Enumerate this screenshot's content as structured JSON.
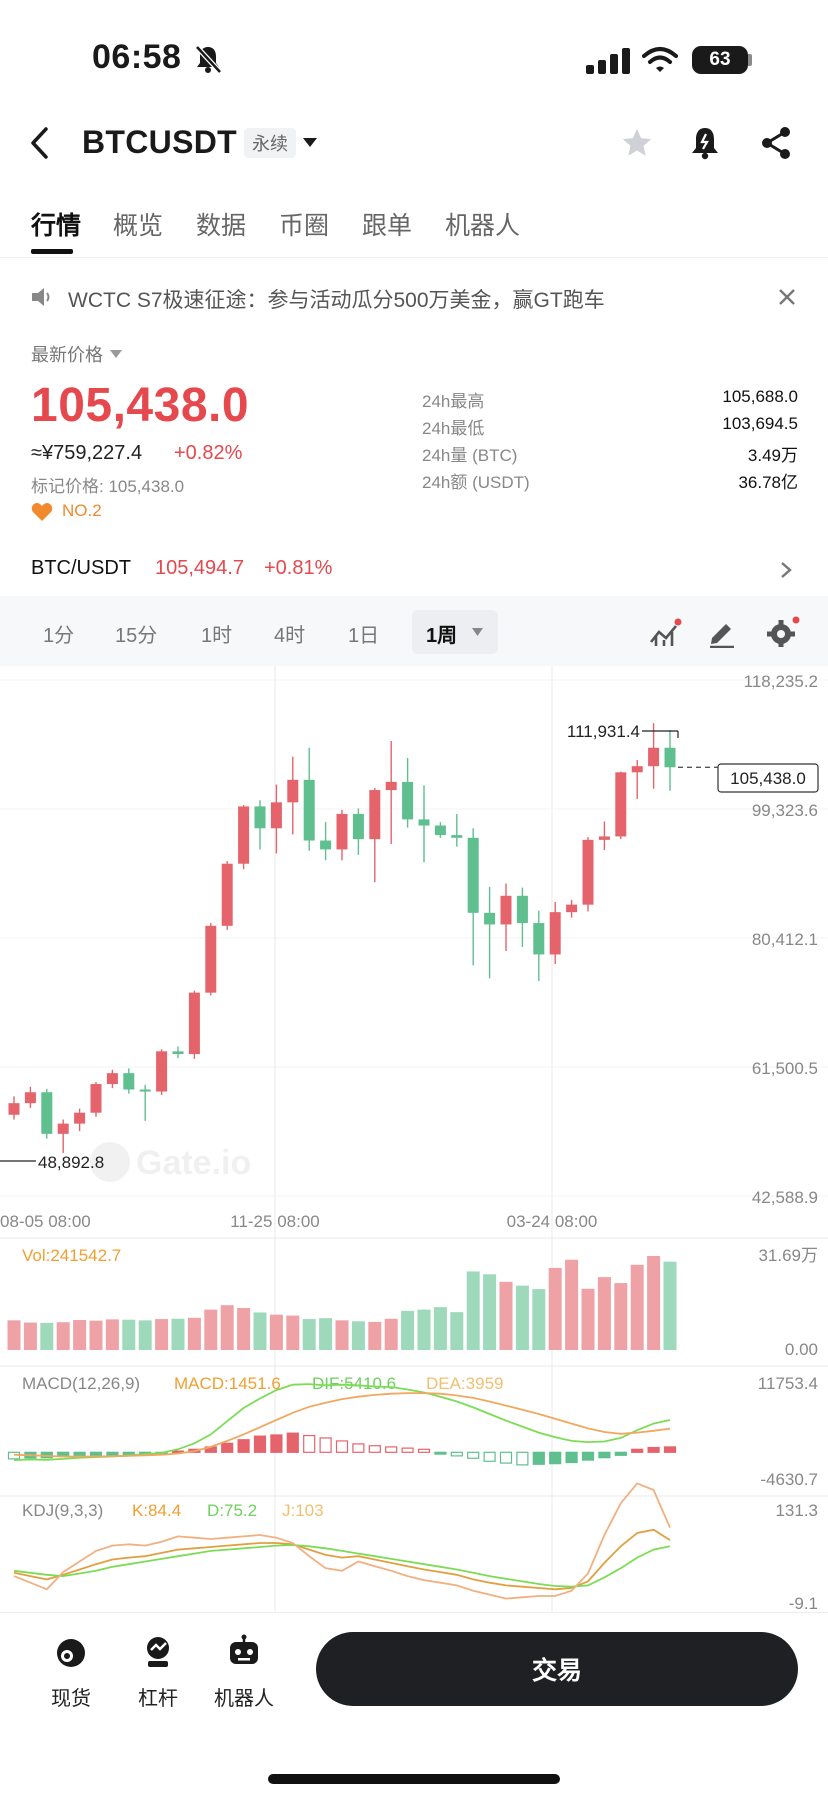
{
  "status_bar": {
    "time": "06:58",
    "battery": "63"
  },
  "header": {
    "pair": "BTCUSDT",
    "contract_type": "永续"
  },
  "tabs": [
    "行情",
    "概览",
    "数据",
    "币圈",
    "跟单",
    "机器人"
  ],
  "announcement": "WCTC S7极速征途：参与活动瓜分500万美金，赢GT跑车",
  "price": {
    "label": "最新价格",
    "last": "105,438.0",
    "cny": "≈¥759,227.4",
    "change": "+0.82%",
    "mark": "标记价格: 105,438.0",
    "rank": "NO.2"
  },
  "stats": [
    {
      "label": "24h最高",
      "value": "105,688.0"
    },
    {
      "label": "24h最低",
      "value": "103,694.5"
    },
    {
      "label": "24h量 (BTC)",
      "value": "3.49万"
    },
    {
      "label": "24h额 (USDT)",
      "value": "36.78亿"
    }
  ],
  "spot": {
    "pair": "BTC/USDT",
    "price": "105,494.7",
    "change": "+0.81%"
  },
  "intervals": [
    "1分",
    "15分",
    "1时",
    "4时",
    "1日",
    "1周"
  ],
  "active_interval": "1周",
  "colors": {
    "up": "#e5636b",
    "down": "#5fbf8e",
    "price_red": "#e5484d"
  },
  "chart_data": {
    "type": "candlestick",
    "y_axis_labels": [
      "118,235.2",
      "99,323.6",
      "80,412.1",
      "61,500.5",
      "42,588.9"
    ],
    "x_axis_labels": [
      "08-05 08:00",
      "11-25 08:00",
      "03-24 08:00"
    ],
    "ylim": [
      42588.9,
      118235.2
    ],
    "high_marker": "111,931.4",
    "low_marker": "48,892.8",
    "current_price_tag": "105,438.0",
    "watermark": "Gate.io",
    "candles": [
      [
        54500,
        57200,
        53800,
        56200
      ],
      [
        56200,
        58600,
        55500,
        57800
      ],
      [
        57800,
        58300,
        51000,
        51700
      ],
      [
        51700,
        53800,
        48900,
        53200
      ],
      [
        53200,
        55400,
        52100,
        54800
      ],
      [
        54800,
        59300,
        54200,
        59000
      ],
      [
        59000,
        61100,
        58400,
        60600
      ],
      [
        60600,
        61300,
        57600,
        58200
      ],
      [
        58200,
        58900,
        53600,
        57900
      ],
      [
        57900,
        64100,
        57400,
        63800
      ],
      [
        63800,
        64500,
        62800,
        63400
      ],
      [
        63400,
        72700,
        62700,
        72400
      ],
      [
        72400,
        82600,
        72000,
        82200
      ],
      [
        82200,
        91700,
        81600,
        91300
      ],
      [
        91300,
        99900,
        90500,
        99700
      ],
      [
        99700,
        100600,
        93400,
        96500
      ],
      [
        96500,
        102900,
        92800,
        100300
      ],
      [
        100300,
        107000,
        95600,
        103600
      ],
      [
        103600,
        108300,
        93200,
        94700
      ],
      [
        94700,
        97400,
        91800,
        93400
      ],
      [
        93400,
        99200,
        91800,
        98600
      ],
      [
        98600,
        99400,
        92600,
        94900
      ],
      [
        94900,
        102400,
        88600,
        102100
      ],
      [
        102100,
        109300,
        94200,
        103300
      ],
      [
        103300,
        106800,
        96600,
        97800
      ],
      [
        97800,
        102800,
        91500,
        96900
      ],
      [
        96900,
        97400,
        95100,
        95500
      ],
      [
        95500,
        98600,
        93800,
        95100
      ],
      [
        95100,
        96500,
        76400,
        84100
      ],
      [
        84100,
        87900,
        74500,
        82400
      ],
      [
        82400,
        88400,
        78500,
        86600
      ],
      [
        86600,
        87800,
        79100,
        82600
      ],
      [
        82600,
        84400,
        74100,
        78000
      ],
      [
        78000,
        85700,
        76600,
        84200
      ],
      [
        84200,
        86000,
        83400,
        85300
      ],
      [
        85300,
        95200,
        84300,
        94800
      ],
      [
        94800,
        97500,
        93300,
        95300
      ],
      [
        95300,
        104800,
        94900,
        104700
      ],
      [
        104700,
        106500,
        100800,
        105600
      ],
      [
        105600,
        111900,
        102300,
        108300
      ],
      [
        108300,
        110900,
        102000,
        105438
      ]
    ],
    "volume": {
      "label": "Vol:241542.7",
      "axis_top": "31.69万",
      "axis_bottom": "0.00",
      "values": [
        9.4,
        8.7,
        8.6,
        8.8,
        9.5,
        9.3,
        9.7,
        9.6,
        9.4,
        9.8,
        9.9,
        10.2,
        12.8,
        14.2,
        13.3,
        11.9,
        11.2,
        10.9,
        9.8,
        10.1,
        9.4,
        9.1,
        8.9,
        9.9,
        12.4,
        12.8,
        13.6,
        12.0,
        24.9,
        24.0,
        21.6,
        20.4,
        19.3,
        26.0,
        28.6,
        19.4,
        23.1,
        21.2,
        27.0,
        29.8,
        28.0
      ]
    },
    "macd": {
      "label": "MACD(12,26,9)",
      "macd": "MACD:1451.6",
      "dif": "DIF:5410.6",
      "dea": "DEA:3959",
      "axis_top": "11753.4",
      "axis_bottom": "-4630.7",
      "hist": [
        -1100,
        -950,
        -900,
        -700,
        -600,
        -500,
        -450,
        -350,
        -250,
        -100,
        200,
        500,
        900,
        1500,
        2100,
        2700,
        2900,
        3200,
        2800,
        2400,
        1900,
        1400,
        1100,
        900,
        700,
        500,
        -300,
        -600,
        -1000,
        -1500,
        -1800,
        -2100,
        -2000,
        -1900,
        -1700,
        -1300,
        -900,
        -500,
        500,
        800,
        900
      ],
      "dif_line": [
        -1300,
        -1200,
        -1250,
        -1100,
        -900,
        -800,
        -700,
        -500,
        -300,
        -100,
        500,
        1500,
        3000,
        5200,
        7400,
        9000,
        10400,
        11300,
        11400,
        11200,
        11300,
        11200,
        11000,
        10900,
        10500,
        10000,
        9300,
        8500,
        7500,
        6400,
        5300,
        4300,
        3300,
        2500,
        1900,
        1700,
        1800,
        2400,
        3700,
        4800,
        5400
      ],
      "dea_line": [
        -400,
        -500,
        -600,
        -700,
        -700,
        -700,
        -650,
        -600,
        -500,
        -400,
        -200,
        200,
        900,
        1900,
        3000,
        4200,
        5400,
        6600,
        7600,
        8300,
        8900,
        9300,
        9600,
        9800,
        9900,
        9900,
        9800,
        9500,
        9100,
        8500,
        7800,
        7100,
        6400,
        5600,
        4800,
        4000,
        3400,
        3100,
        3300,
        3600,
        3959
      ]
    },
    "kdj": {
      "label": "KDJ(9,3,3)",
      "k": "K:84.4",
      "d": "D:75.2",
      "j": "J:103",
      "axis_top": "131.3",
      "axis_bottom": "-9.1",
      "k_line": [
        35,
        30,
        25,
        32,
        40,
        48,
        55,
        58,
        60,
        65,
        70,
        72,
        74,
        76,
        78,
        80,
        80,
        78,
        70,
        62,
        58,
        60,
        55,
        50,
        45,
        40,
        36,
        32,
        25,
        20,
        16,
        14,
        12,
        10,
        12,
        22,
        50,
        75,
        95,
        100,
        84.4
      ],
      "d_line": [
        38,
        35,
        32,
        30,
        34,
        38,
        44,
        48,
        52,
        56,
        60,
        64,
        68,
        70,
        72,
        74,
        76,
        77,
        75,
        72,
        68,
        64,
        60,
        56,
        52,
        48,
        44,
        40,
        35,
        30,
        26,
        22,
        18,
        15,
        14,
        16,
        28,
        42,
        58,
        70,
        75.2
      ],
      "j_line": [
        30,
        20,
        10,
        36,
        52,
        68,
        76,
        78,
        76,
        82,
        90,
        88,
        86,
        88,
        90,
        92,
        88,
        80,
        60,
        42,
        38,
        52,
        45,
        38,
        30,
        24,
        20,
        16,
        8,
        2,
        -4,
        -2,
        0,
        0,
        8,
        34,
        92,
        140,
        170,
        160,
        103
      ]
    }
  },
  "bottom_nav": [
    {
      "label": "现货",
      "icon": "spot-icon"
    },
    {
      "label": "杠杆",
      "icon": "leverage-icon"
    },
    {
      "label": "机器人",
      "icon": "robot-icon"
    }
  ],
  "trade_button": "交易"
}
